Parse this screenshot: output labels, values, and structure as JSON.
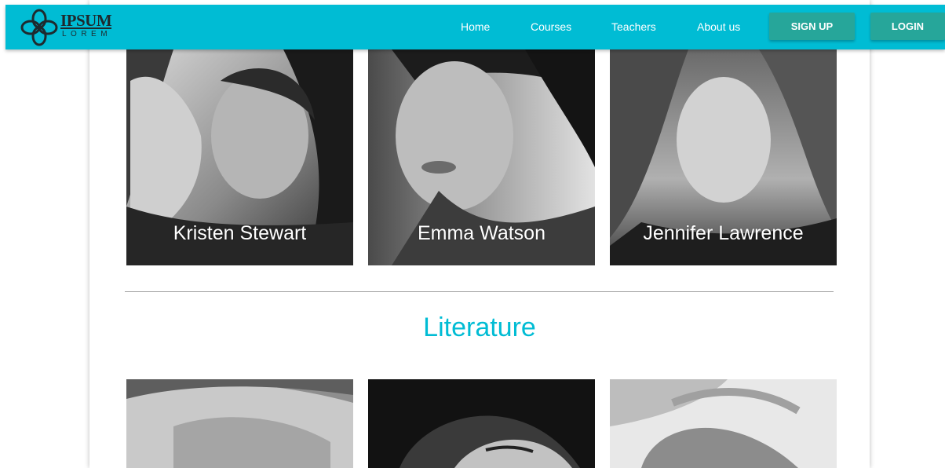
{
  "brand": {
    "name": "IPSUM",
    "subtitle": "LOREM"
  },
  "nav": {
    "links": [
      "Home",
      "Courses",
      "Teachers",
      "About us"
    ],
    "signup_label": "SIGN UP",
    "login_label": "LOGIN"
  },
  "teachers": [
    {
      "name": "Kristen Stewart"
    },
    {
      "name": "Emma Watson"
    },
    {
      "name": "Jennifer Lawrence"
    }
  ],
  "literature": {
    "title": "Literature"
  },
  "colors": {
    "accent": "#00bcd4",
    "button": "#26a69a",
    "text_light": "#ffffff"
  }
}
